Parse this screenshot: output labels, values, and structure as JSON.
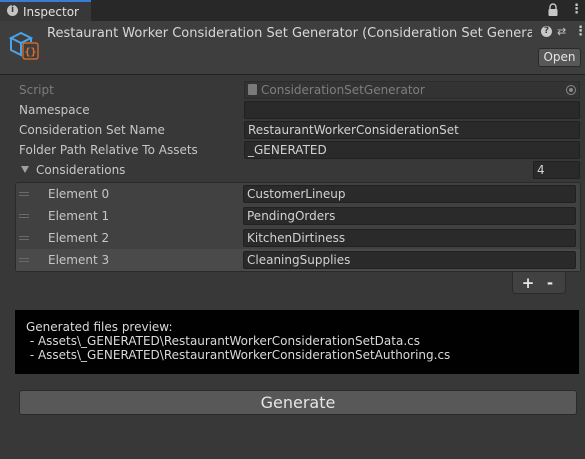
{
  "tab": {
    "title": "Inspector",
    "info_glyph": "i"
  },
  "header": {
    "title": "Restaurant Worker Consideration Set Generator (Consideration Set Generato",
    "help_glyph": "?",
    "preset_glyph": "⇄",
    "open_label": "Open"
  },
  "properties": {
    "script": {
      "label": "Script",
      "value": "ConsiderationSetGenerator"
    },
    "namespace": {
      "label": "Namespace",
      "value": ""
    },
    "set_name": {
      "label": "Consideration Set Name",
      "value": "RestaurantWorkerConsiderationSet"
    },
    "folder_path": {
      "label": "Folder Path Relative To Assets",
      "value": "_GENERATED"
    },
    "considerations": {
      "label": "Considerations",
      "size": "4"
    }
  },
  "considerations": [
    {
      "label": "Element 0",
      "value": "CustomerLineup"
    },
    {
      "label": "Element 1",
      "value": "PendingOrders"
    },
    {
      "label": "Element 2",
      "value": "KitchenDirtiness"
    },
    {
      "label": "Element 3",
      "value": "CleaningSupplies"
    }
  ],
  "list_controls": {
    "add": "+",
    "remove": "-"
  },
  "preview": {
    "title": "Generated files preview:",
    "lines": [
      " - Assets\\_GENERATED\\RestaurantWorkerConsiderationSetData.cs",
      " - Assets\\_GENERATED\\RestaurantWorkerConsiderationSetAuthoring.cs"
    ]
  },
  "generate_label": "Generate",
  "colors": {
    "accent": "#3a7bd5",
    "panel": "#383838",
    "field": "#2a2a2a",
    "script_icon_blue": "#4aa3e8",
    "script_icon_orange": "#e8722a"
  }
}
